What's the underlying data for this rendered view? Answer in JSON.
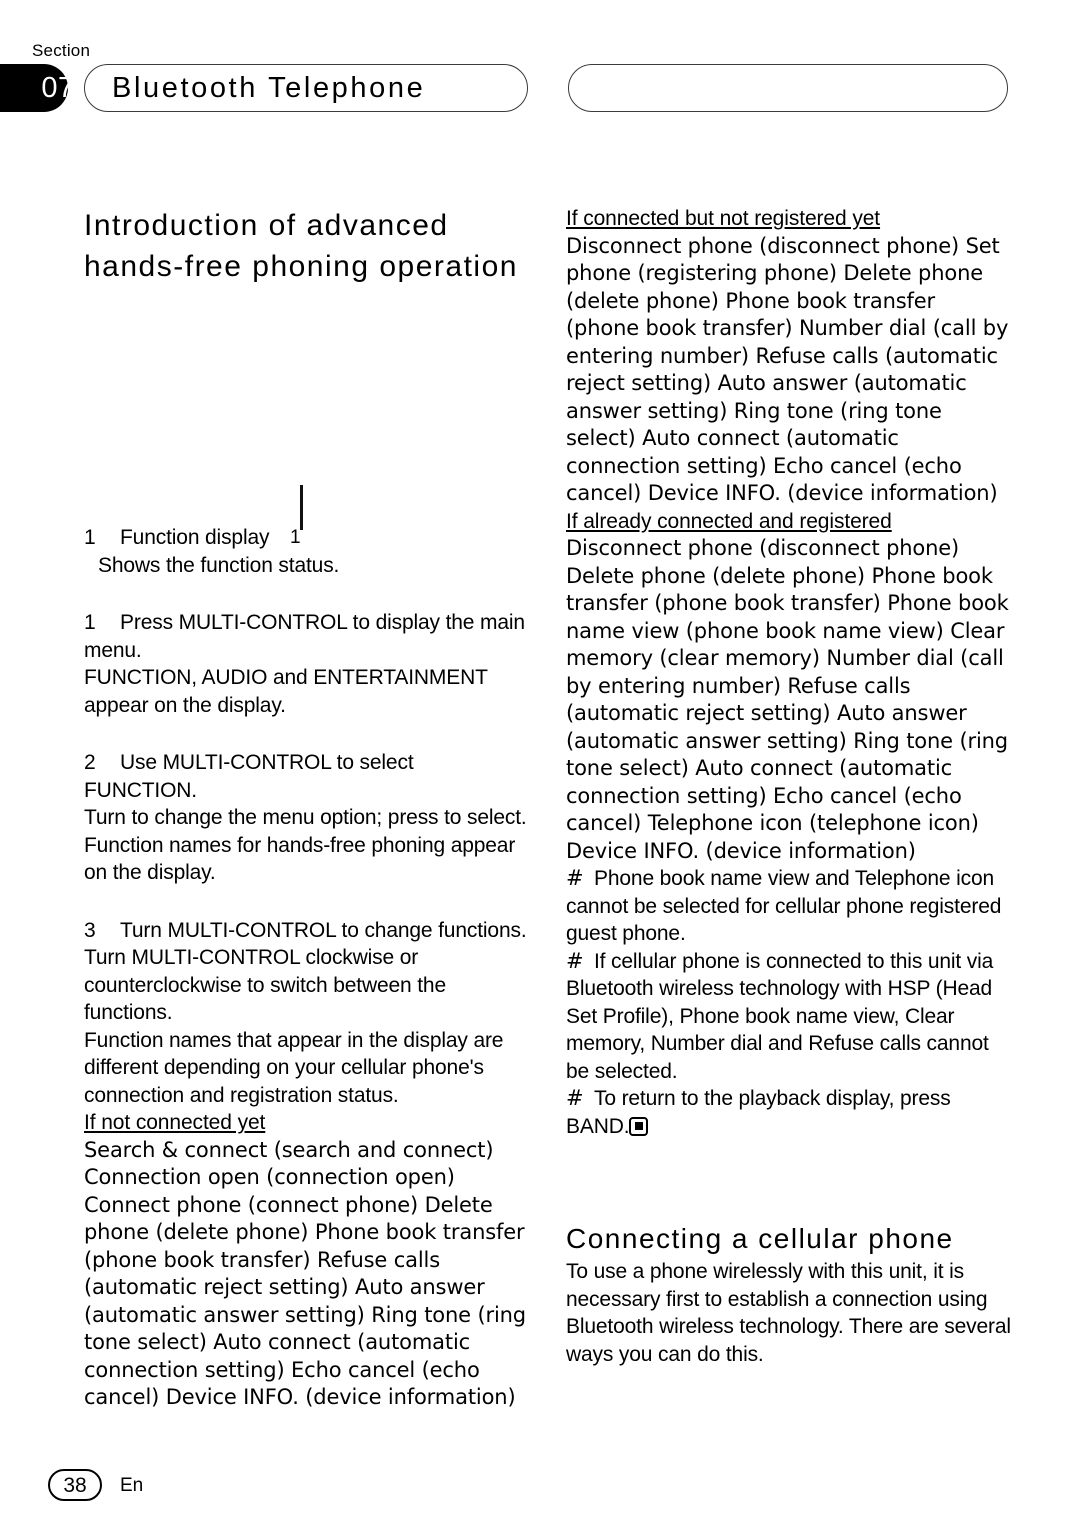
{
  "header": {
    "section_word": "Section",
    "section_number": "07",
    "chapter_title": "Bluetooth Telephone",
    "right_pill_label": ""
  },
  "left_column": {
    "section_title": "Introduction of advanced hands-free phoning operation",
    "figure": {
      "callout_number": "1"
    },
    "callout_legend": {
      "number": "1",
      "label": "Function display",
      "description": "Shows the function status."
    },
    "steps": [
      {
        "number": "1",
        "instruction": "Press MULTI-CONTROL to display the main menu.",
        "detail": "FUNCTION, AUDIO and ENTERTAINMENT appear on the display."
      },
      {
        "number": "2",
        "instruction": "Use MULTI-CONTROL to select FUNCTION.",
        "detail": "Turn to change the menu option; press to select.",
        "detail2": "Function names for hands-free phoning appear on the display."
      },
      {
        "number": "3",
        "instruction": "Turn MULTI-CONTROL to change functions.",
        "detail": "Turn MULTI-CONTROL clockwise or counterclockwise to switch between the functions.",
        "detail2": "Function names that appear in the display are different depending on your cellular phone's connection and registration status."
      }
    ],
    "state_heading": "If not connected yet",
    "state_functions": "Search & connect (search and connect) Connection open (connection open) Connect phone (connect phone) Delete phone (delete phone) Phone book transfer (phone book transfer) Refuse calls (automatic reject setting) Auto answer (automatic answer setting) Ring tone (ring tone select)  Auto connect (automatic connection setting)  Echo cancel (echo cancel)  Device INFO. (device information)"
  },
  "right_column": {
    "state1_heading": "If connected but not registered yet",
    "state1_functions": "Disconnect phone (disconnect phone) Set phone (registering phone) Delete phone (delete phone) Phone book transfer (phone book transfer) Number dial (call by entering number) Refuse calls (automatic reject setting) Auto answer (automatic answer setting) Ring tone (ring tone select)  Auto connect (automatic connection setting)  Echo cancel (echo cancel)  Device INFO. (device information)",
    "state2_heading": "If already connected and registered",
    "state2_functions": "Disconnect phone (disconnect phone) Delete phone (delete phone) Phone book transfer (phone book transfer) Phone book name view (phone book name view)  Clear memory (clear memory) Number dial (call by entering number) Refuse calls (automatic reject setting) Auto answer (automatic answer setting) Ring tone (ring tone select)  Auto connect (automatic connection setting)  Echo cancel (echo cancel)  Telephone icon (telephone icon)  Device INFO. (device information)",
    "notes": [
      {
        "marker": "#",
        "text": "Phone book name view and Telephone icon cannot be selected for cellular phone registered guest phone."
      },
      {
        "marker": "#",
        "text": "If cellular phone is connected to this unit via Bluetooth wireless technology with HSP (Head Set Profile), Phone book name view, Clear memory, Number dial and Refuse calls cannot be selected."
      },
      {
        "marker": "#",
        "text": "To return to the playback display, press BAND."
      }
    ],
    "sub_title": "Connecting a cellular phone",
    "sub_body": "To use a phone wirelessly with this unit, it is necessary first to establish a connection using Bluetooth wireless technology. There are several ways you can do this."
  },
  "footer": {
    "page_number": "38",
    "language": "En"
  }
}
